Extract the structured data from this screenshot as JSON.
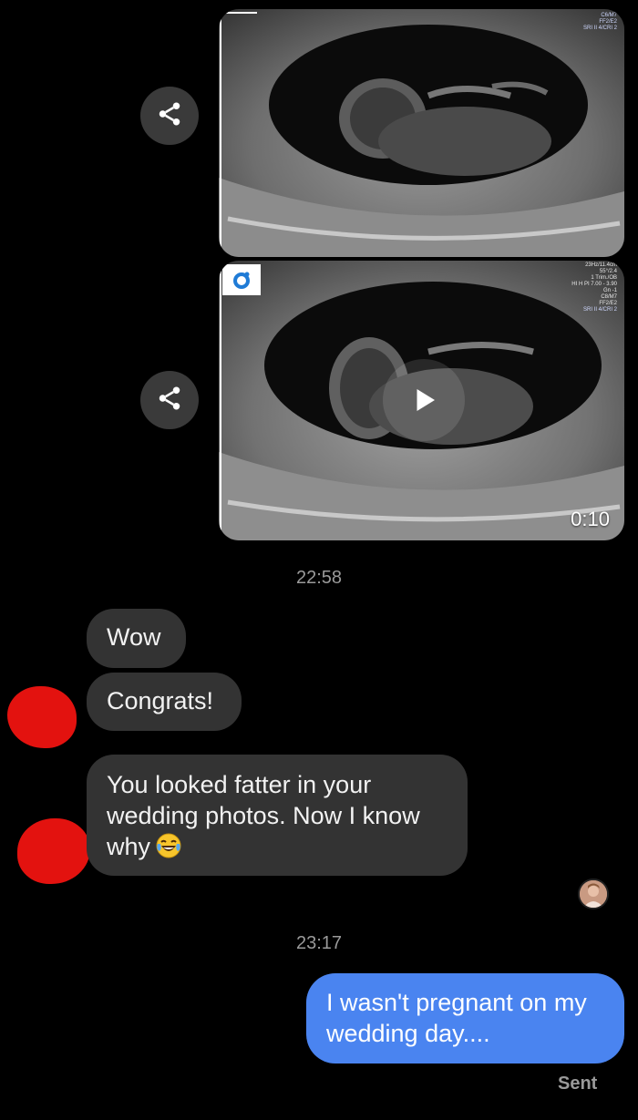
{
  "media": [
    {
      "kind": "image",
      "overlay_lines": [
        "C6/M7",
        "FF2/E2",
        "SRI II 4/CRI 2"
      ]
    },
    {
      "kind": "video",
      "overlay_lines": [
        "23Hz/11.4cm",
        "55°/2.4",
        "1 Trim./OB",
        "HI H PI 7.00 - 3.90",
        "Gn -1",
        "C8/M7",
        "FF2/E2",
        "SRI II 4/CRI 2"
      ],
      "duration": "0:10"
    }
  ],
  "timestamps": {
    "first": "22:58",
    "second": "23:17"
  },
  "messages": {
    "wow": "Wow",
    "congrats": "Congrats!",
    "fatter": "You looked fatter in your wedding photos. Now I know why",
    "reply": "I wasn't pregnant on my wedding day...."
  },
  "status": {
    "sent": "Sent"
  },
  "icons": {
    "share": "share-icon",
    "play": "play-icon",
    "emoji": "tears-of-joy-emoji"
  },
  "colors": {
    "background": "#000000",
    "incoming_bubble": "#333333",
    "outgoing_bubble": "#4a84f0",
    "redaction": "#e3120f"
  }
}
